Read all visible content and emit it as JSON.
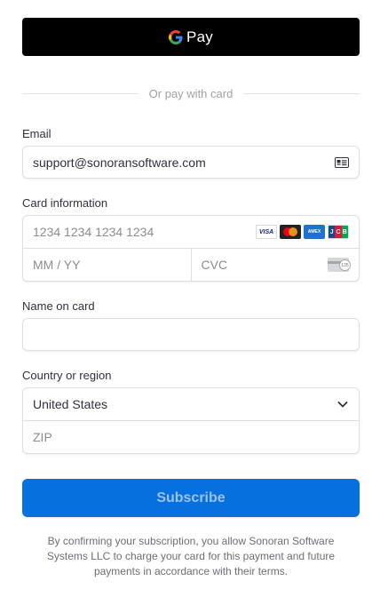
{
  "gpay": {
    "label": "Pay"
  },
  "divider": {
    "text": "Or pay with card"
  },
  "email": {
    "label": "Email",
    "value": "support@sonoransoftware.com"
  },
  "card": {
    "label": "Card information",
    "number_placeholder": "1234 1234 1234 1234",
    "expiry_placeholder": "MM / YY",
    "cvc_placeholder": "CVC",
    "brands": {
      "visa": "VISA",
      "amex": "AMEX",
      "jcb": [
        "J",
        "C",
        "B"
      ]
    },
    "cvc_icon_number": "135"
  },
  "name": {
    "label": "Name on card",
    "value": ""
  },
  "country": {
    "label": "Country or region",
    "selected": "United States",
    "zip_placeholder": "ZIP"
  },
  "subscribe": {
    "label": "Subscribe"
  },
  "terms": {
    "text": "By confirming your subscription, you allow Sonoran Software Systems LLC to charge your card for this payment and future payments in accordance with their terms."
  },
  "colors": {
    "primary": "#0570de",
    "gpay_bg": "#000000",
    "border": "#e0e0e0"
  }
}
